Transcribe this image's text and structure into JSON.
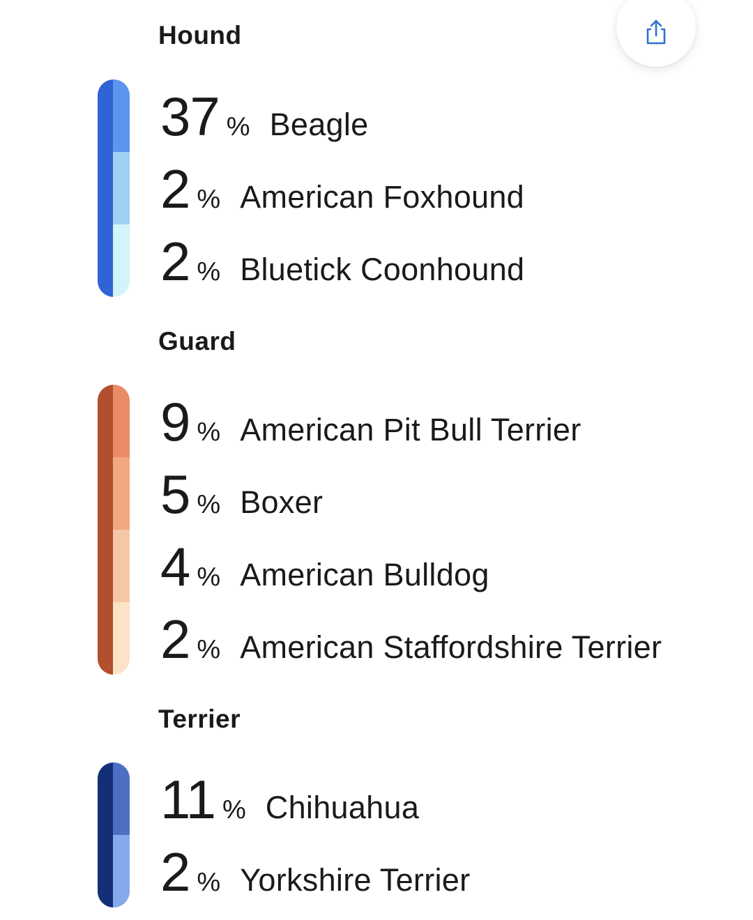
{
  "share_button": {
    "icon": "share-icon",
    "color": "#2f6fd0"
  },
  "groups": [
    {
      "title": "Hound",
      "dark_color": "#2f63d6",
      "rows": [
        {
          "percent": "37",
          "sign": "%",
          "breed": "Beagle",
          "color": "#5b95ef"
        },
        {
          "percent": "2",
          "sign": "%",
          "breed": "American Foxhound",
          "color": "#9fd1f5"
        },
        {
          "percent": "2",
          "sign": "%",
          "breed": "Bluetick Coonhound",
          "color": "#d2f4fb"
        }
      ]
    },
    {
      "title": "Guard",
      "dark_color": "#b14f2e",
      "rows": [
        {
          "percent": "9",
          "sign": "%",
          "breed": "American Pit Bull Terrier",
          "color": "#e98c66"
        },
        {
          "percent": "5",
          "sign": "%",
          "breed": "Boxer",
          "color": "#f2a880"
        },
        {
          "percent": "4",
          "sign": "%",
          "breed": "American Bulldog",
          "color": "#f6c7a6"
        },
        {
          "percent": "2",
          "sign": "%",
          "breed": "American Staffordshire Terrier",
          "color": "#fbe3c5"
        }
      ]
    },
    {
      "title": "Terrier",
      "dark_color": "#132f78",
      "rows": [
        {
          "percent": "11",
          "sign": "%",
          "breed": "Chihuahua",
          "color": "#4c6fc4"
        },
        {
          "percent": "2",
          "sign": "%",
          "breed": "Yorkshire Terrier",
          "color": "#85a9ec"
        }
      ]
    }
  ]
}
